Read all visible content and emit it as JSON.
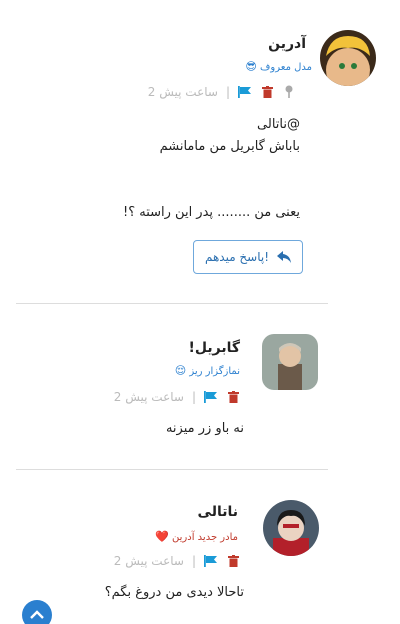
{
  "comments": [
    {
      "author": "آدرین",
      "badge_text": "مدل معروف",
      "badge_emoji": "😎",
      "badge_color": "#2a7fcf",
      "time": "2 ساعت پیش",
      "separator": "|",
      "lines": [
        "@ناتالی",
        "باباش گابریل من مامانشم",
        "یعنی من ........ پدر این راسته ؟!"
      ],
      "reply_label": "پاسخ میدهم!"
    },
    {
      "author": "گابریل!",
      "badge_text": "نمازگزار ریز",
      "badge_emoji": "😌",
      "badge_color": "#2a7fcf",
      "time": "2 ساعت پیش",
      "separator": "|",
      "lines": [
        "نه باو زر میزنه"
      ]
    },
    {
      "author": "ناتالی",
      "badge_text": "مادر جدید آدرین",
      "badge_emoji": "❤️",
      "badge_color": "#c0392b",
      "time": "2 ساعت پیش",
      "separator": "|",
      "lines": [
        "تاحالا دیدی من دروغ بگم؟"
      ]
    }
  ],
  "colors": {
    "accent": "#2a7fcf",
    "trash": "#c0392b",
    "flag": "#1a9bd7",
    "pin": "#aaaaaa"
  },
  "icons": [
    "pin-icon",
    "trash-icon",
    "flag-icon",
    "reply-icon",
    "chevron-up-icon"
  ]
}
